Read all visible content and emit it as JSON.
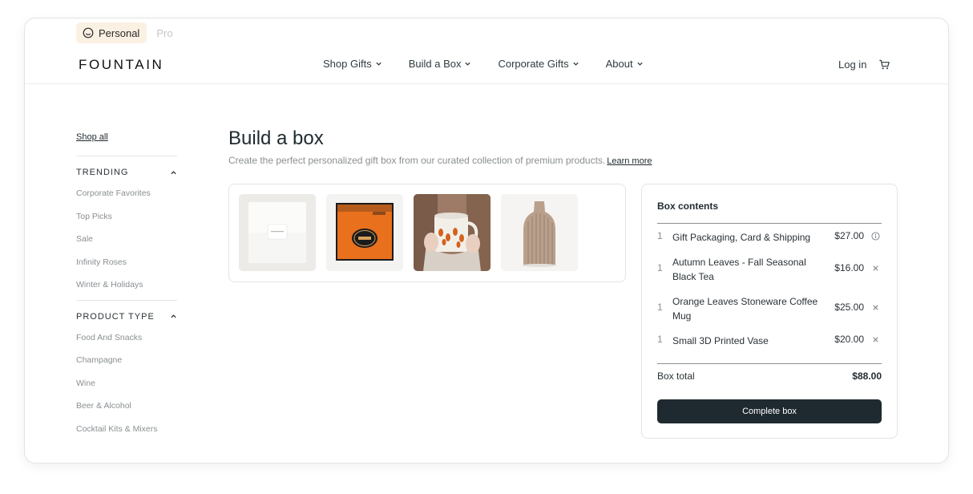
{
  "switcher": {
    "personal_label": "Personal",
    "pro_label": "Pro"
  },
  "header": {
    "logo": "FOUNTAIN",
    "nav": [
      {
        "label": "Shop Gifts"
      },
      {
        "label": "Build a Box"
      },
      {
        "label": "Corporate Gifts"
      },
      {
        "label": "About"
      }
    ],
    "login_label": "Log in"
  },
  "sidebar": {
    "shop_all": "Shop all",
    "trending": {
      "heading": "TRENDING",
      "items": [
        "Corporate Favorites",
        "Top Picks",
        "Sale",
        "Infinity Roses",
        "Winter & Holidays"
      ]
    },
    "product_type": {
      "heading": "PRODUCT TYPE",
      "items": [
        "Food And Snacks",
        "Champagne",
        "Wine",
        "Beer & Alcohol",
        "Cocktail Kits & Mixers"
      ]
    }
  },
  "main": {
    "title": "Build a box",
    "subtitle": "Create the perfect personalized gift box from our curated collection of premium products.",
    "learn_more": "Learn more"
  },
  "box": {
    "title": "Box contents",
    "items": [
      {
        "qty": "1",
        "name": "Gift Packaging, Card & Shipping",
        "price": "$27.00",
        "action_icon": "info-icon"
      },
      {
        "qty": "1",
        "name": "Autumn Leaves - Fall Seasonal Black Tea",
        "price": "$16.00",
        "action_icon": "remove-icon"
      },
      {
        "qty": "1",
        "name": "Orange Leaves Stoneware Coffee Mug",
        "price": "$25.00",
        "action_icon": "remove-icon"
      },
      {
        "qty": "1",
        "name": "Small 3D Printed Vase",
        "price": "$20.00",
        "action_icon": "remove-icon"
      }
    ],
    "total_label": "Box total",
    "total_value": "$88.00",
    "complete_label": "Complete box"
  },
  "colors": {
    "accent_dark": "#1f2a30",
    "personal_badge_bg": "#fbf1e3",
    "tea_orange": "#e9701c"
  }
}
